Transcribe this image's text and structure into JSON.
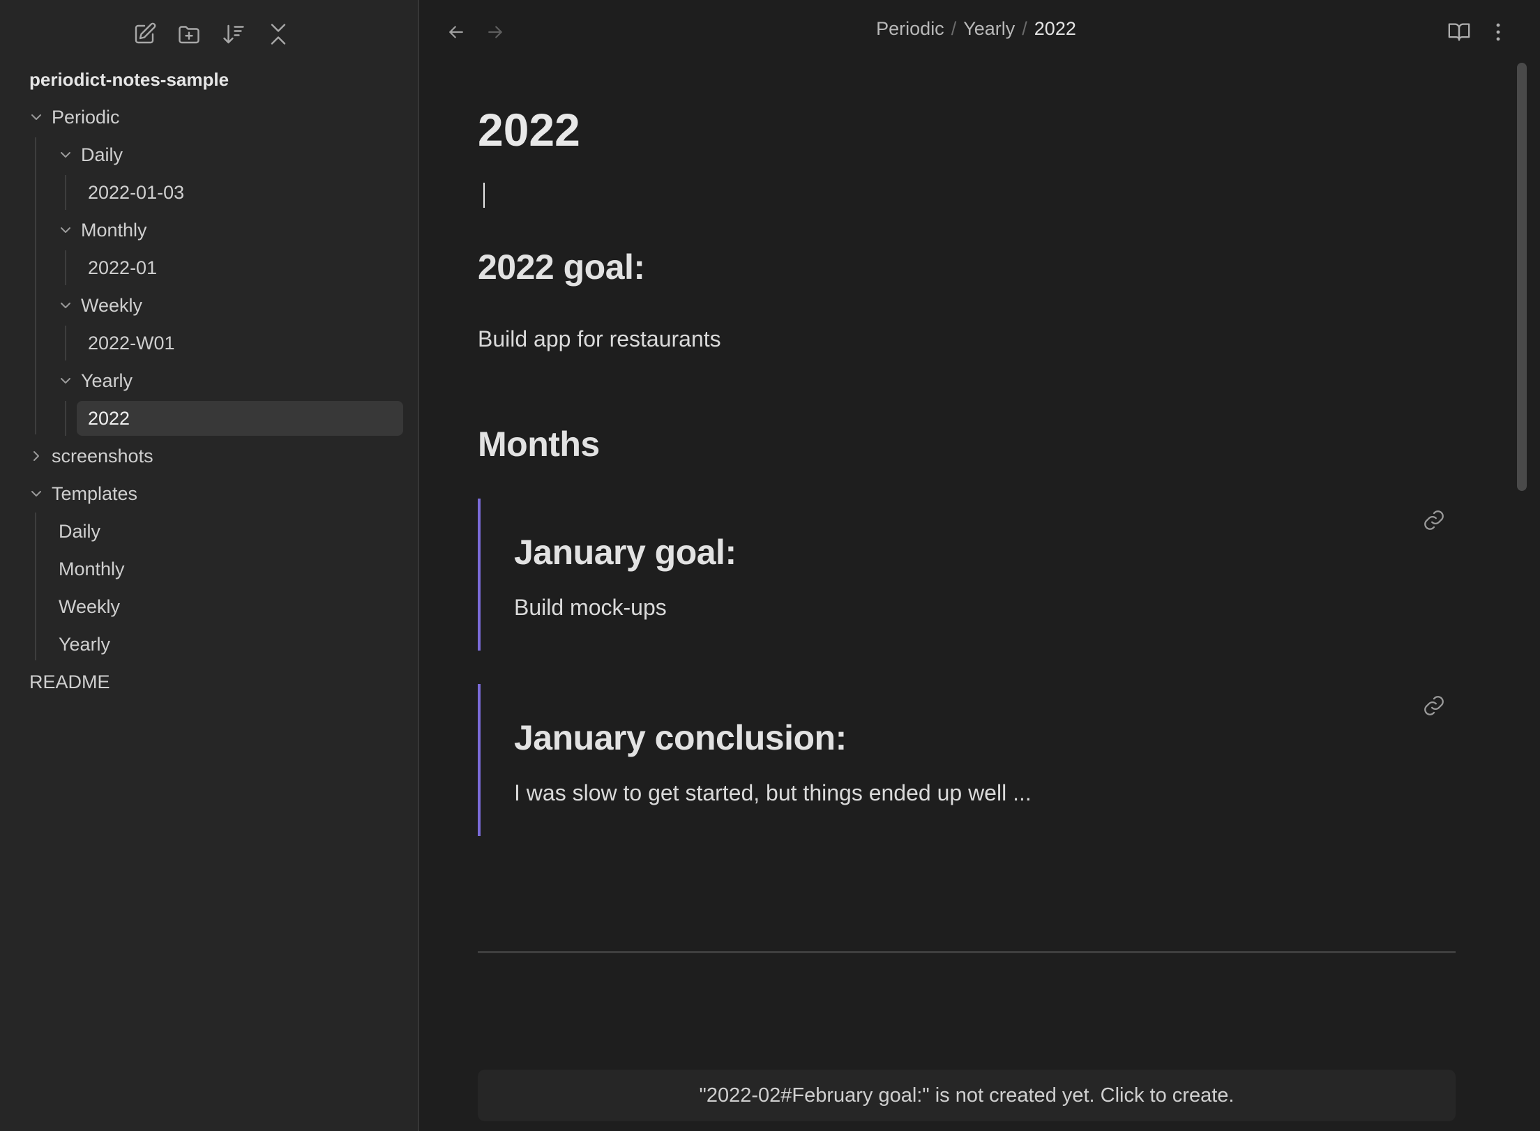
{
  "sidebar": {
    "toolbar": {
      "new_note": "edit-icon",
      "new_folder": "folder-plus-icon",
      "sort": "sort-icon",
      "collapse": "collapse-all-icon"
    },
    "vault_name": "periodict-notes-sample",
    "tree": {
      "periodic": "Periodic",
      "daily": "Daily",
      "daily_file": "2022-01-03",
      "monthly": "Monthly",
      "monthly_file": "2022-01",
      "weekly": "Weekly",
      "weekly_file": "2022-W01",
      "yearly": "Yearly",
      "yearly_file": "2022",
      "screenshots": "screenshots",
      "templates": "Templates",
      "tpl_daily": "Daily",
      "tpl_monthly": "Monthly",
      "tpl_weekly": "Weekly",
      "tpl_yearly": "Yearly",
      "readme": "README"
    }
  },
  "header": {
    "breadcrumb": [
      "Periodic",
      "Yearly",
      "2022"
    ],
    "separator": "/"
  },
  "note": {
    "title": "2022",
    "goal_heading": "2022 goal:",
    "goal_text": "Build app for restaurants",
    "months_heading": "Months",
    "embeds": [
      {
        "heading": "January goal:",
        "text": "Build mock-ups"
      },
      {
        "heading": "January conclusion:",
        "text": "I was slow to get started, but things ended up well ..."
      }
    ],
    "unresolved_notice": "\"2022-02#February goal:\" is not created yet. Click to create."
  },
  "colors": {
    "accent": "#7b6cd9",
    "background": "#1e1e1e",
    "sidebar_bg": "#262626"
  }
}
